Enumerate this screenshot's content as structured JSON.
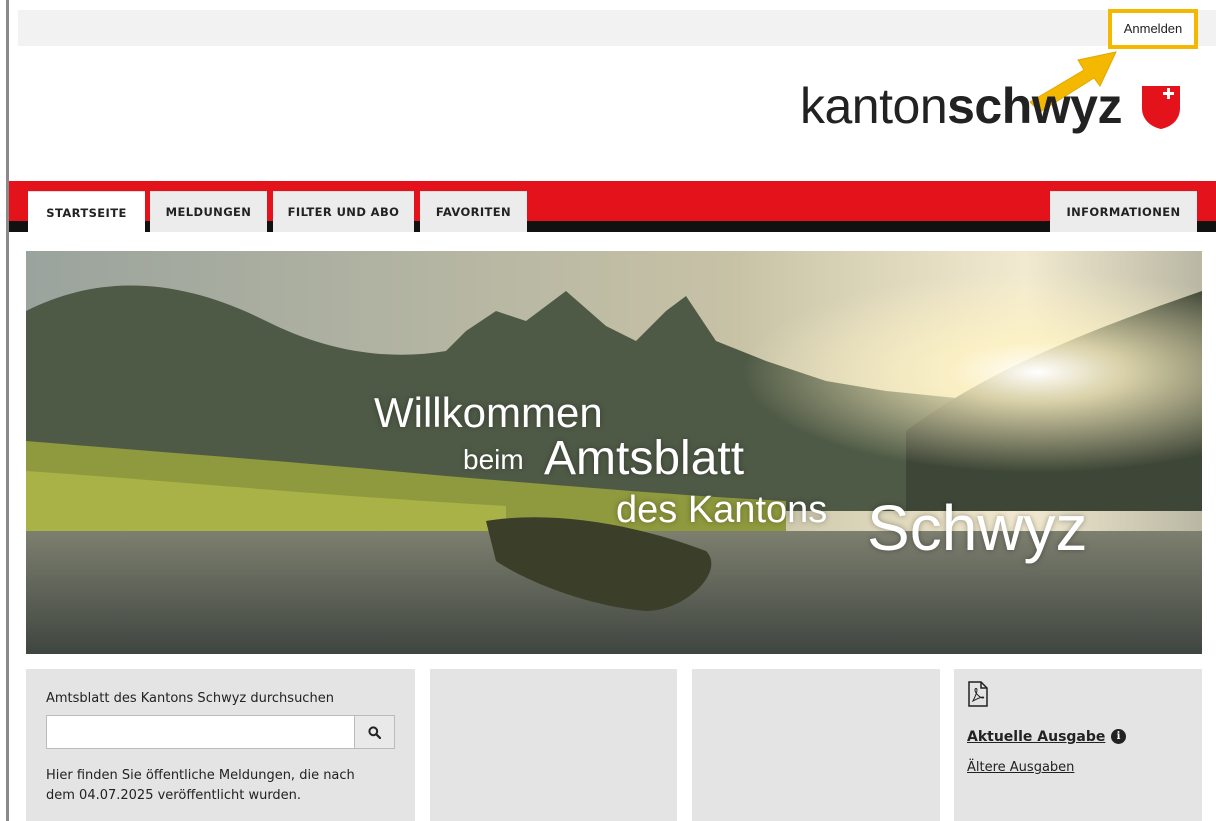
{
  "header": {
    "login_label": "Anmelden",
    "logo": {
      "prefix": "kanton",
      "bold": "schwyz"
    }
  },
  "nav": {
    "tabs": [
      {
        "label": "STARTSEITE",
        "active": true
      },
      {
        "label": "MELDUNGEN",
        "active": false
      },
      {
        "label": "FILTER UND ABO",
        "active": false
      },
      {
        "label": "FAVORITEN",
        "active": false
      }
    ],
    "right_tab": {
      "label": "INFORMATIONEN"
    }
  },
  "hero": {
    "line1": "Willkommen",
    "line2_small": "beim",
    "line2_big": "Amtsblatt",
    "line3_small": "des Kantons",
    "line3_big": "Schwyz"
  },
  "search": {
    "title": "Amtsblatt des Kantons Schwyz durchsuchen",
    "value": "",
    "note": "Hier finden Sie öffentliche Meldungen, die nach dem 04.07.2025 veröffentlicht wurden."
  },
  "issues": {
    "current_label": "Aktuelle Ausgabe",
    "info_glyph": "i",
    "older_label": "Ältere Ausgaben"
  },
  "colors": {
    "brand_red": "#e3121b",
    "highlight": "#f5b800",
    "panel_gray": "#e4e4e4"
  }
}
